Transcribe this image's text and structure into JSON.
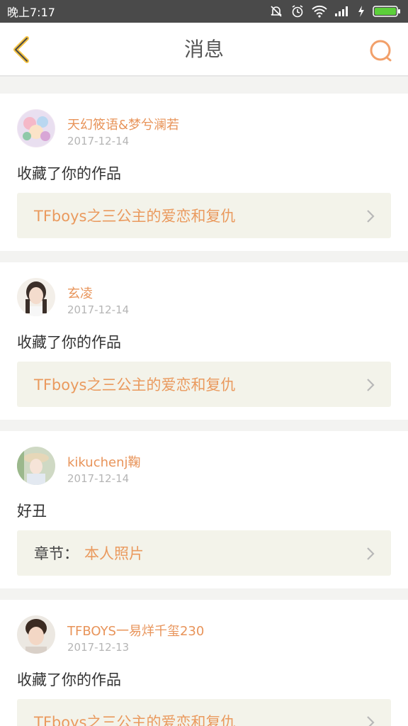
{
  "status_bar": {
    "time": "晚上7:17",
    "icons": [
      "mute-icon",
      "alarm-icon",
      "wifi-icon",
      "signal-icon",
      "charging-icon",
      "battery-icon"
    ]
  },
  "header": {
    "title": "消息",
    "back_icon": "back-chevron-icon",
    "search_icon": "search-icon"
  },
  "colors": {
    "accent": "#e8945a",
    "status_bar_bg": "#4a4a4a",
    "card_bg": "#ffffff",
    "link_bg": "#f3f3ea",
    "page_bg": "#f3f3f1"
  },
  "messages": [
    {
      "username": "天幻筱语&梦兮澜若",
      "date": "2017-12-14",
      "text": "收藏了你的作品",
      "link_prefix": "",
      "link_title": "TFboys之三公主的爱恋和复仇"
    },
    {
      "username": "玄凌",
      "date": "2017-12-14",
      "text": "收藏了你的作品",
      "link_prefix": "",
      "link_title": "TFboys之三公主的爱恋和复仇"
    },
    {
      "username": "kikuchenj鞠",
      "date": "2017-12-14",
      "text": "好丑",
      "link_prefix": "章节：",
      "link_title": "本人照片"
    },
    {
      "username": "TFBOYS一易烊千玺230",
      "date": "2017-12-13",
      "text": "收藏了你的作品",
      "link_prefix": "",
      "link_title": "TFboys之三公主的爱恋和复仇"
    }
  ]
}
